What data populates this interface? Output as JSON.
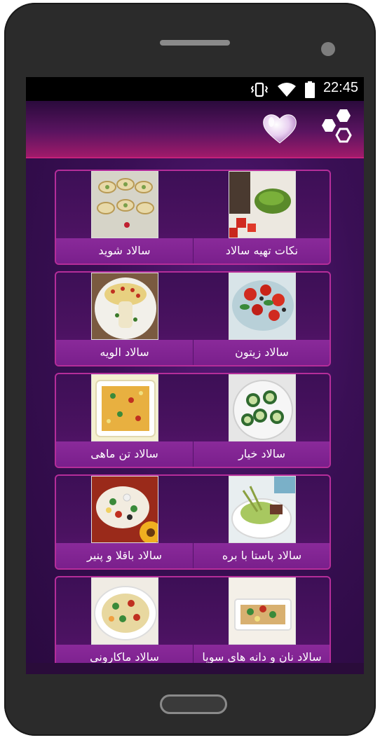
{
  "status": {
    "time": "22:45",
    "icons": [
      "vibrate-icon",
      "wifi-icon",
      "battery-icon"
    ]
  },
  "appbar": {
    "icons": [
      "favorites-heart-icon",
      "hexagons-menu-icon"
    ]
  },
  "colors": {
    "accent": "#b52d9a",
    "label_bar": "#7a1f8c",
    "appbar_bottom": "#a01a6a"
  },
  "items": [
    {
      "right": "نکات تهیه سالاد",
      "left": "سالاد شوید"
    },
    {
      "right": "سالاد زیتون",
      "left": "سالاد الویه"
    },
    {
      "right": "سالاد خیار",
      "left": "سالاد تن ماهی"
    },
    {
      "right": "سالاد پاستا با بره",
      "left": "سالاد باقلا و پنیر"
    },
    {
      "right": "سالاد نان و دانه های سویا",
      "left": "سالاد ماکارونی"
    }
  ]
}
